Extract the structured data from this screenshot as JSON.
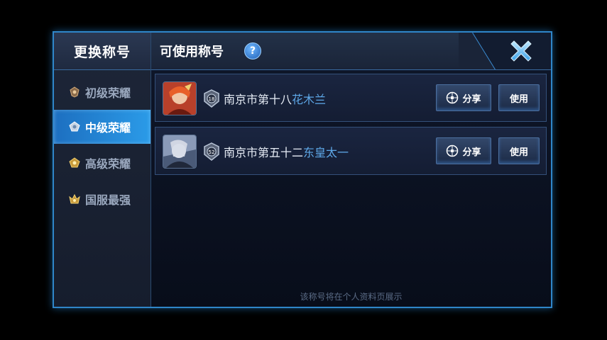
{
  "sidebar": {
    "title": "更换称号",
    "items": [
      {
        "label": "初级荣耀",
        "active": false
      },
      {
        "label": "中级荣耀",
        "active": true
      },
      {
        "label": "高级荣耀",
        "active": false
      },
      {
        "label": "国服最强",
        "active": false
      }
    ]
  },
  "main": {
    "title": "可使用称号",
    "help_label": "?",
    "titles": [
      {
        "prefix": "南京市第十八",
        "hero": "花木兰",
        "rank_badge": "18",
        "share_label": "分享",
        "use_label": "使用",
        "avatar": "hero-avatar-huamulan"
      },
      {
        "prefix": "南京市第五十二",
        "hero": "东皇太一",
        "rank_badge": "52",
        "share_label": "分享",
        "use_label": "使用",
        "avatar": "hero-avatar-donghuangtaiyi"
      }
    ],
    "footer_note": "该称号将在个人资料页展示"
  },
  "colors": {
    "accent": "#2b9be8",
    "hero_name": "#5ea8e8",
    "border": "#2f86c9"
  }
}
